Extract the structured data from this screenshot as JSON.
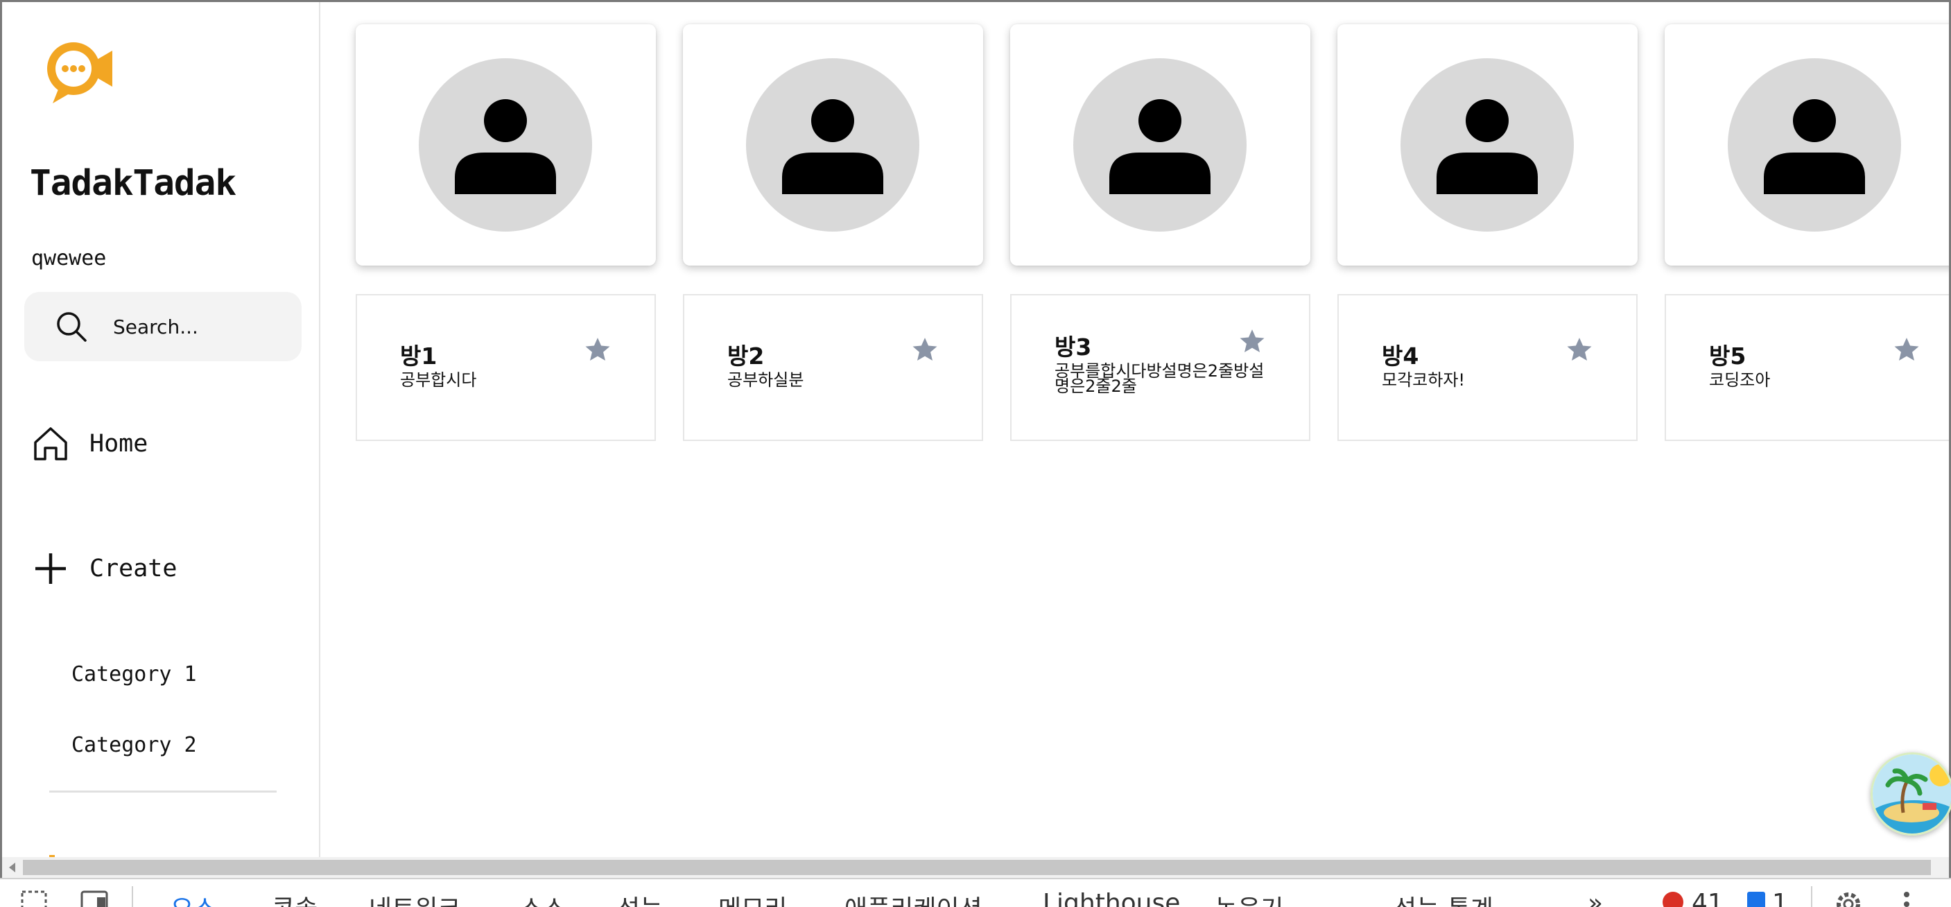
{
  "colors": {
    "brand": "#f2a623",
    "star": "#8a94a6",
    "avatar_bg": "#d9d9d9",
    "devtools_active": "#1a73e8"
  },
  "sidebar": {
    "app_title": "TadakTadak",
    "username": "qwewee",
    "search": {
      "placeholder": "Search..."
    },
    "nav": [
      {
        "label": "Home",
        "icon": "home-icon"
      },
      {
        "label": "Create",
        "icon": "plus-icon"
      }
    ],
    "categories": [
      "Category 1",
      "Category 2"
    ]
  },
  "rooms": [
    {
      "title": "방1",
      "description": "공부합시다"
    },
    {
      "title": "방2",
      "description": "공부하실분"
    },
    {
      "title": "방3",
      "description": "공부를합시다방설명은2줄방설명은2줄2줄"
    },
    {
      "title": "방4",
      "description": "모각코하자!"
    },
    {
      "title": "방5",
      "description": "코딩조아"
    }
  ],
  "devtools": {
    "tabs": [
      "요소",
      "콘솔",
      "네트워크",
      "소스",
      "성능",
      "메모리",
      "애플리케이션",
      "Lighthouse",
      "녹음기",
      "성능 통계"
    ],
    "error_count": "41",
    "message_count": "1"
  }
}
